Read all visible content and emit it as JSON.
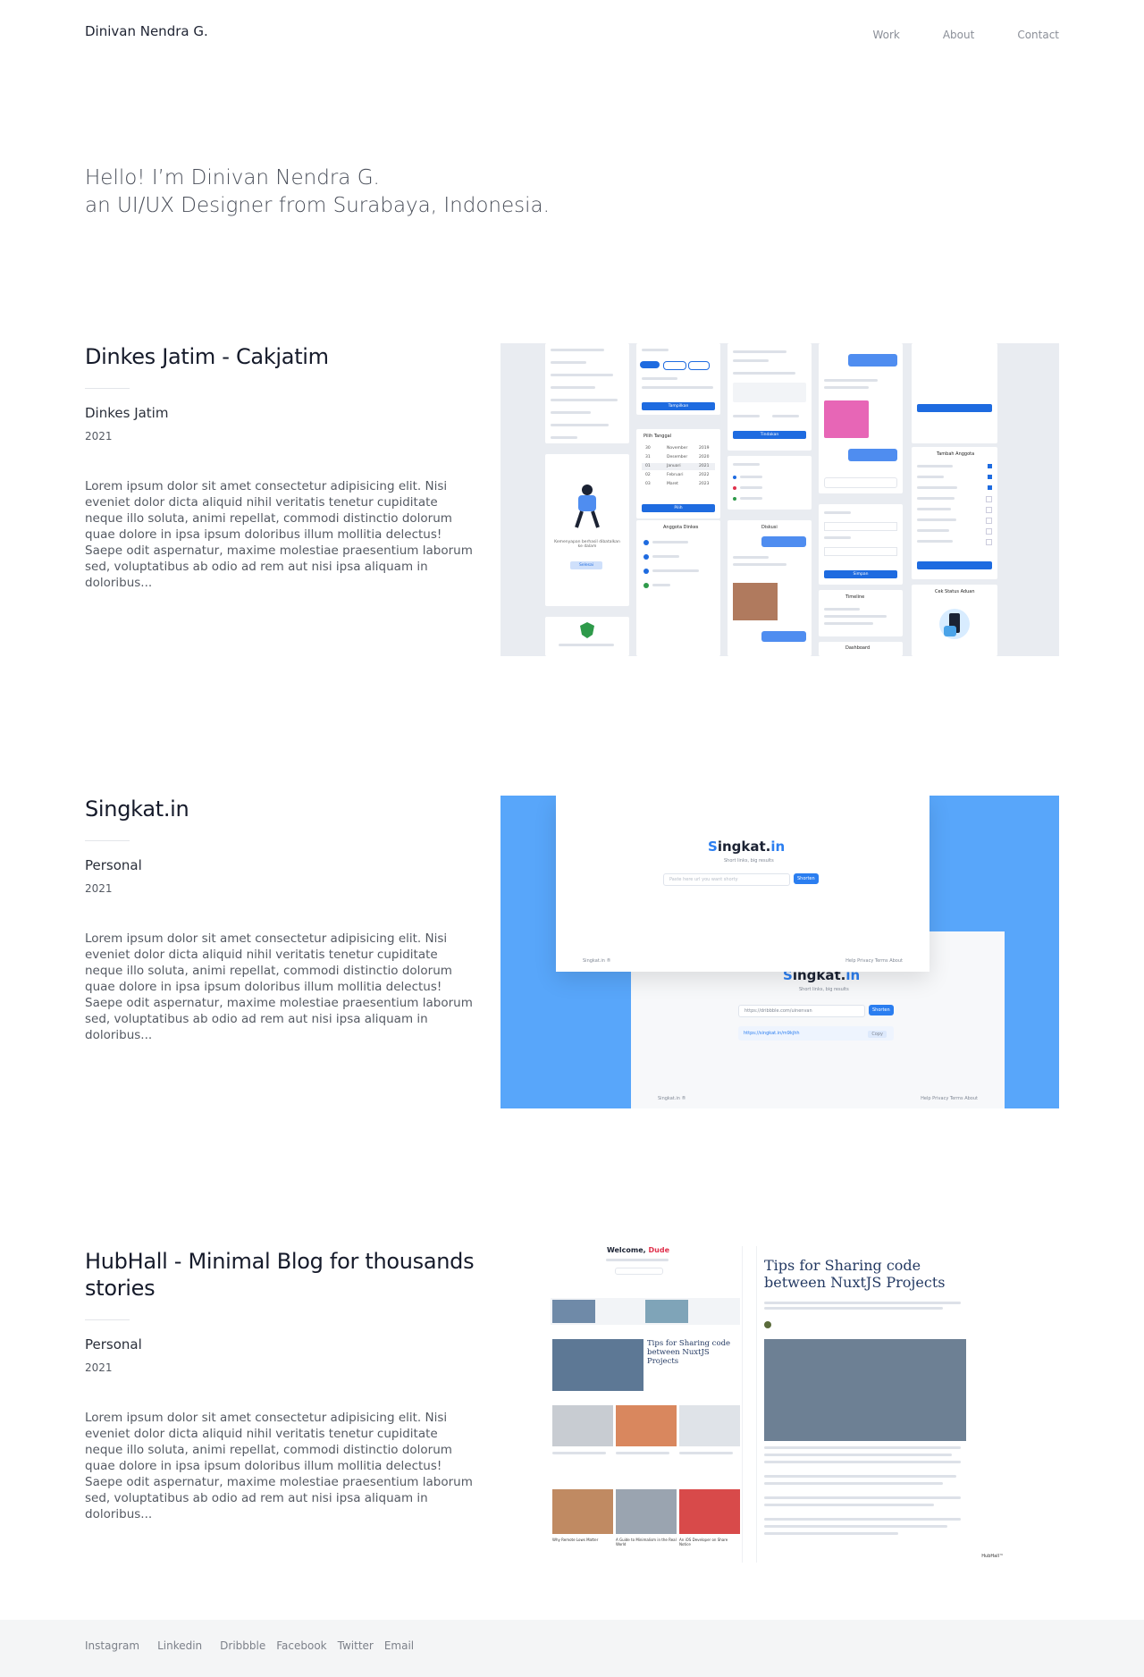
{
  "brand": "Dinivan Nendra G.",
  "nav": [
    "Work",
    "About",
    "Contact"
  ],
  "hero": {
    "line1": "Hello! I’m Dinivan Nendra G.",
    "line2": "an UI/UX Designer from Surabaya, Indonesia."
  },
  "projects": [
    {
      "title": "Dinkes Jatim - Cakjatim",
      "client": "Dinkes Jatim",
      "year": "2021",
      "description": "Lorem ipsum dolor sit amet consectetur adipisicing elit. Nisi eveniet dolor dicta aliquid nihil veritatis tenetur cupiditate neque illo soluta, animi repellat, commodi distinctio dolorum quae dolore in ipsa ipsum doloribus illum mollitia delectus! Saepe odit aspernatur, maxime molestiae praesentium laborum sed, voluptatibus ab odio ad rem aut nisi ipsa aliquam in doloribus..."
    },
    {
      "title": "Singkat.in",
      "client": "Personal",
      "year": "2021",
      "description": "Lorem ipsum dolor sit amet consectetur adipisicing elit. Nisi eveniet dolor dicta aliquid nihil veritatis tenetur cupiditate neque illo soluta, animi repellat, commodi distinctio dolorum quae dolore in ipsa ipsum doloribus illum mollitia delectus! Saepe odit aspernatur, maxime molestiae praesentium laborum sed, voluptatibus ab odio ad rem aut nisi ipsa aliquam in doloribus..."
    },
    {
      "title": "HubHall - Minimal Blog for thousands stories",
      "client": "Personal",
      "year": "2021",
      "description": "Lorem ipsum dolor sit amet consectetur adipisicing elit. Nisi eveniet dolor dicta aliquid nihil veritatis tenetur cupiditate neque illo soluta, animi repellat, commodi distinctio dolorum quae dolore in ipsa ipsum doloribus illum mollitia delectus! Saepe odit aspernatur, maxime molestiae praesentium laborum sed, voluptatibus ab odio ad rem aut nisi ipsa aliquam in doloribus..."
    }
  ],
  "dinkes_mock": {
    "btn_tampilkan": "Tampilkan",
    "btn_pilih": "Pilih",
    "btn_tindakan": "Tindakan",
    "btn_simpan": "Simpan",
    "date_title": "Pilih Tanggal",
    "months": [
      "November",
      "Desember",
      "Januari",
      "Februari",
      "Maret"
    ],
    "years": [
      "2019",
      "2020",
      "2021",
      "2022",
      "2023"
    ],
    "days": [
      "30",
      "31",
      "01",
      "02",
      "03"
    ],
    "list_title": "Anggota Dinkes",
    "chat_title": "Diskusi",
    "timeline_title": "Timeline",
    "status_title": "Cek Status Aduan",
    "member_title": "Tambah Anggota",
    "dashboard": "Dashboard",
    "empty_caption": "Kemenyapan berhasil dibatalkan ke dalam",
    "empty_btn": "Selesai"
  },
  "singkat_mock": {
    "logo_prefix": "S",
    "logo_main": "ingkat.",
    "logo_suffix": "in",
    "tagline": "Short links, big results",
    "placeholder": "Paste here url you want shorty",
    "shorten_btn": "Shorten",
    "url_value": "https://dribbble.com/uinenvan",
    "short_url": "https://singkat.in/m9kjhh",
    "copy_btn": "Copy",
    "footer_brand": "Singkat.in ®",
    "footer_links": [
      "Help",
      "Privacy",
      "Terms",
      "About"
    ]
  },
  "hub_mock": {
    "welcome": "Welcome,",
    "welcome_name": "Dude",
    "article_title": "Tips for Sharing code between NuxtJS Projects",
    "card_titles": [
      "Why Remote Lows Matter",
      "A Guide to Minimalism in the Real World",
      "An iOS Developer on Share Notice"
    ],
    "footer_brand": "HubHall™"
  },
  "footer": [
    "Instagram",
    "Linkedin",
    "Dribbble",
    "Facebook",
    "Twitter",
    "Email"
  ],
  "colors": {
    "accent": "#1e6be0",
    "singkat_bg": "#58a6fa",
    "hub_red": "#e0314c"
  }
}
